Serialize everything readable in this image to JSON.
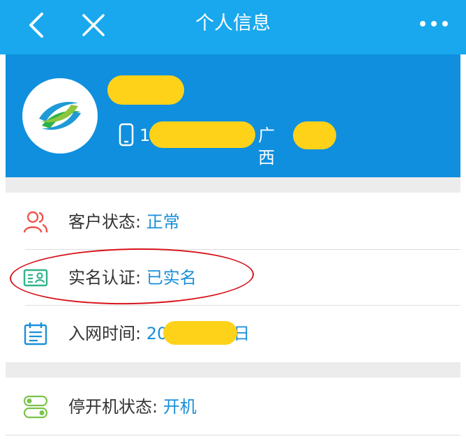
{
  "navbar": {
    "title": "个人信息",
    "back_icon": "chevron-left-icon",
    "close_icon": "close-icon",
    "more_icon": "more-dots-icon"
  },
  "profile": {
    "logo_icon": "china-mobile-logo-icon",
    "phone_prefix": "1",
    "province": "广西"
  },
  "info_rows": [
    {
      "icon": "users-icon",
      "label": "客户状态:",
      "value": "正常"
    },
    {
      "icon": "id-card-icon",
      "label": "实名认证:",
      "value": "已实名"
    },
    {
      "icon": "calendar-icon",
      "label": "入网时间:",
      "value_prefix": "20",
      "value_suffix": "日"
    },
    {
      "icon": "toggle-icon",
      "label": "停开机状态:",
      "value": "开机"
    }
  ],
  "colors": {
    "navbar": "#19a8ee",
    "header": "#0f8fde",
    "value_text": "#1a8fd9",
    "highlight_ellipse": "#d7141c",
    "redaction": "#ffd21a"
  }
}
